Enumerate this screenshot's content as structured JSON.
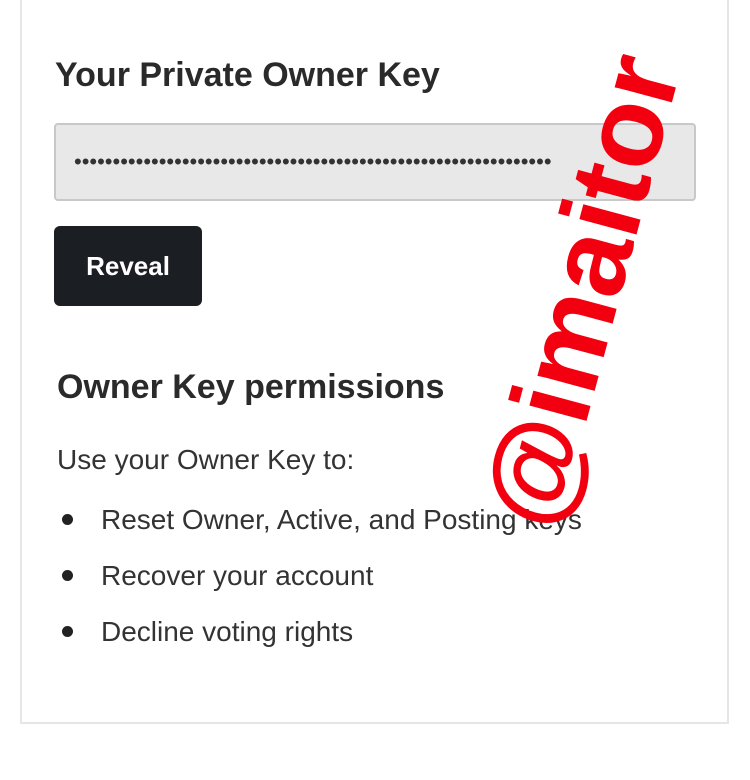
{
  "key_section": {
    "title": "Your Private Owner Key",
    "masked_value": "••••••••••••••••••••••••••••••••••••••••••••••••••••••••••••••",
    "reveal_label": "Reveal"
  },
  "permissions": {
    "title": "Owner Key permissions",
    "intro": "Use your Owner Key to:",
    "items": [
      {
        "label": "Reset Owner, Active, and Posting keys"
      },
      {
        "label": "Recover your account"
      },
      {
        "label": "Decline voting rights"
      }
    ]
  },
  "watermark": {
    "text": "@imaitor",
    "color": "#f2000f"
  },
  "colors": {
    "button_bg": "#1b1e22",
    "input_bg": "#e8e8e8"
  }
}
